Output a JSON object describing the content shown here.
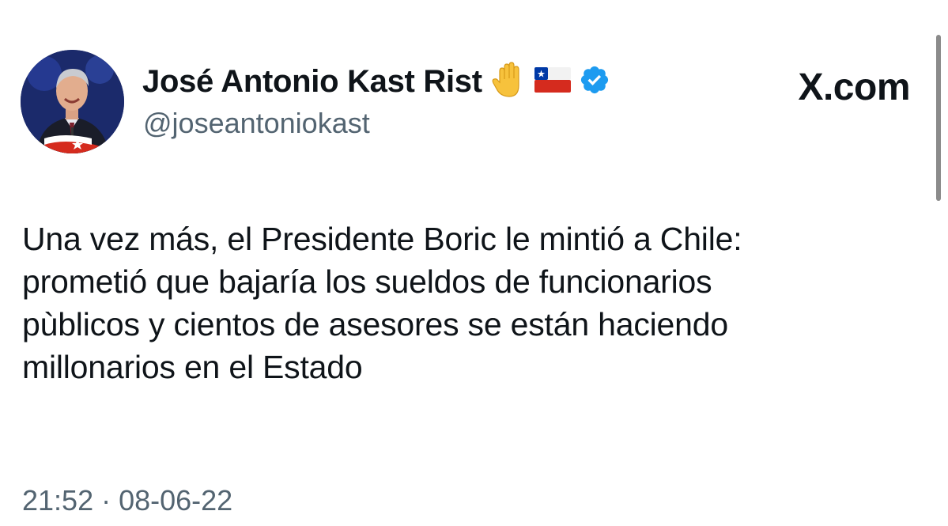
{
  "author": {
    "display_name": "José Antonio Kast Rist",
    "handle": "@joseantoniokast",
    "avatar_icon": "profile-photo",
    "badges": [
      "raised-hand-emoji",
      "chile-flag-emoji",
      "verified-badge-icon"
    ]
  },
  "brand": {
    "label": "X.com"
  },
  "tweet": {
    "text": "Una vez más, el Presidente Boric le mintió a Chile:\nprometió que bajaría los sueldos de funcionarios\npùblicos y cientos de asesores se están haciendo\nmillonarios en el Estado",
    "timestamp": "21:52 · 08-06-22"
  },
  "colors": {
    "text_primary": "#0f1419",
    "text_secondary": "#536471",
    "verified_blue": "#1d9bf0",
    "background": "#ffffff"
  }
}
